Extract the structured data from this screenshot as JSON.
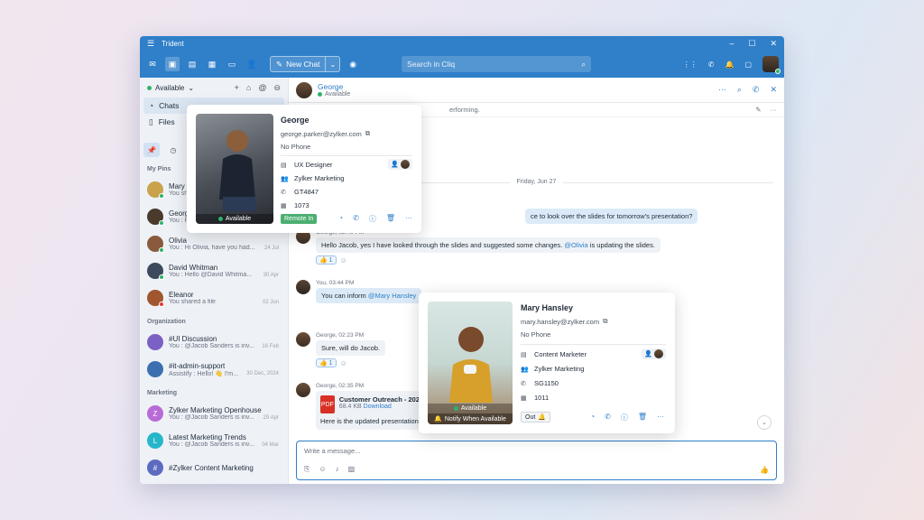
{
  "window": {
    "title": "Trident"
  },
  "toolbar": {
    "new_chat": "New Chat",
    "search_placeholder": "Search in Cliq"
  },
  "sidebar": {
    "status": "Available",
    "nav": [
      {
        "label": "Chats"
      },
      {
        "label": "Files"
      }
    ],
    "sections": {
      "pins": "My Pins",
      "org": "Organization",
      "marketing": "Marketing"
    },
    "pins": [
      {
        "name": "Mary H",
        "preview": "You shared a f",
        "date": "",
        "color": "#c9a24b",
        "status": "#2fb36b"
      },
      {
        "name": "George",
        "preview": "You : Hello George!",
        "date": "",
        "color": "#4a3a2c",
        "status": "#2fb36b"
      },
      {
        "name": "Olivia",
        "preview": "You : Hi Olivia, have you had...",
        "date": "24 Jul",
        "color": "#8a5a3c",
        "status": "#2fb36b"
      },
      {
        "name": "David Whitman",
        "preview": "You : Hello @David Whitma...",
        "date": "30 Apr",
        "color": "#3b4a5c",
        "status": "#2fb36b"
      },
      {
        "name": "Eleanor",
        "preview": "You shared a file",
        "date": "02 Jun",
        "color": "#a0562f",
        "status": "#e53935"
      }
    ],
    "org": [
      {
        "name": "#UI Discussion",
        "preview": "You : @Jacob Sanders  is inv...",
        "date": "16 Feb",
        "color": "#7b61c4"
      },
      {
        "name": "#it-admin-support",
        "preview": "Assistify : Hello! 👋 I'm...",
        "date": "30 Dec, 2024",
        "color": "#3c6fb0"
      }
    ],
    "marketing": [
      {
        "name": "Zylker Marketing Openhouse",
        "preview": "You : @Jacob Sanders  is inv...",
        "date": "29 Apr",
        "color": "#b86bd6",
        "letter": "Z"
      },
      {
        "name": "Latest Marketing Trends",
        "preview": "You : @Jacob Sanders  is inv...",
        "date": "04 Mar",
        "color": "#26b6c9",
        "letter": "L"
      },
      {
        "name": "#Zylker Content Marketing",
        "preview": "",
        "date": "",
        "color": "#5c6bc0",
        "letter": "#"
      }
    ]
  },
  "chat": {
    "name": "George",
    "status": "Available",
    "topic_end": "erforming.",
    "day": "Friday, Jun 27",
    "m1_text": "ce to look over the slides for tomorrow's presentation?",
    "m2_meta": "George, 02:40 PM",
    "m2_text": "Hello Jacob, yes I have looked through the slides and suggested some changes. ",
    "m2_mention": "@Olivia",
    "m2_tail": " is updating the slides.",
    "react_count": "👍 1",
    "m3_meta": "You, 03:44 PM",
    "m3_text": "You can inform ",
    "m3_mention": "@Mary  Hansley",
    "m4_meta": "George, 02:23 PM",
    "m4_text": "Sure, will do Jacob.",
    "m5_meta": "George, 02:35 PM",
    "file_name": "Customer Outreach - 202",
    "file_size": "68.4 KB",
    "file_dl": "Download",
    "m5_text": "Here is the updated presentation",
    "composer_ph": "Write a message..."
  },
  "card_george": {
    "name": "George",
    "email": "george.parker@zylker.com",
    "phone": "No Phone",
    "role": "UX Designer",
    "dept": "Zylker Marketing",
    "ext": "GT4847",
    "desk": "1073",
    "avail": "Available",
    "tag": "Remote In"
  },
  "card_mary": {
    "name": "Mary  Hansley",
    "email": "mary.hansley@zylker.com",
    "phone": "No Phone",
    "role": "Content Marketer",
    "dept": "Zylker Marketing",
    "ext": "SG1150",
    "desk": "1011",
    "avail": "Available",
    "notify": "Notify When Available",
    "tag": "Out"
  }
}
